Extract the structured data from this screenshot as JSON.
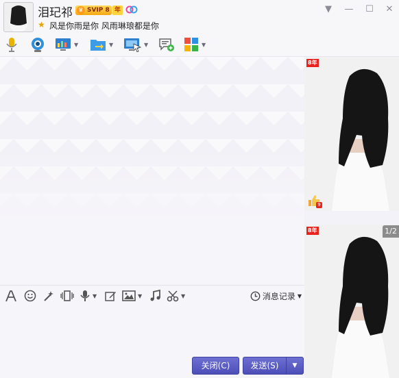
{
  "contact": {
    "nickname": "泪玘祁",
    "svip": "SVIP 8",
    "year": "年",
    "signature": "风是你雨是你 风雨琳琅都是你"
  },
  "input_toolbar": {
    "history_label": "消息记录"
  },
  "buttons": {
    "close_label": "关闭(C)",
    "send_label": "发送(S)"
  },
  "right_panel": {
    "badge_level": "8年",
    "like_count": "9",
    "page_indicator": "1/2"
  },
  "colors": {
    "button": "#5254bc",
    "accent_red": "#e8231d"
  }
}
